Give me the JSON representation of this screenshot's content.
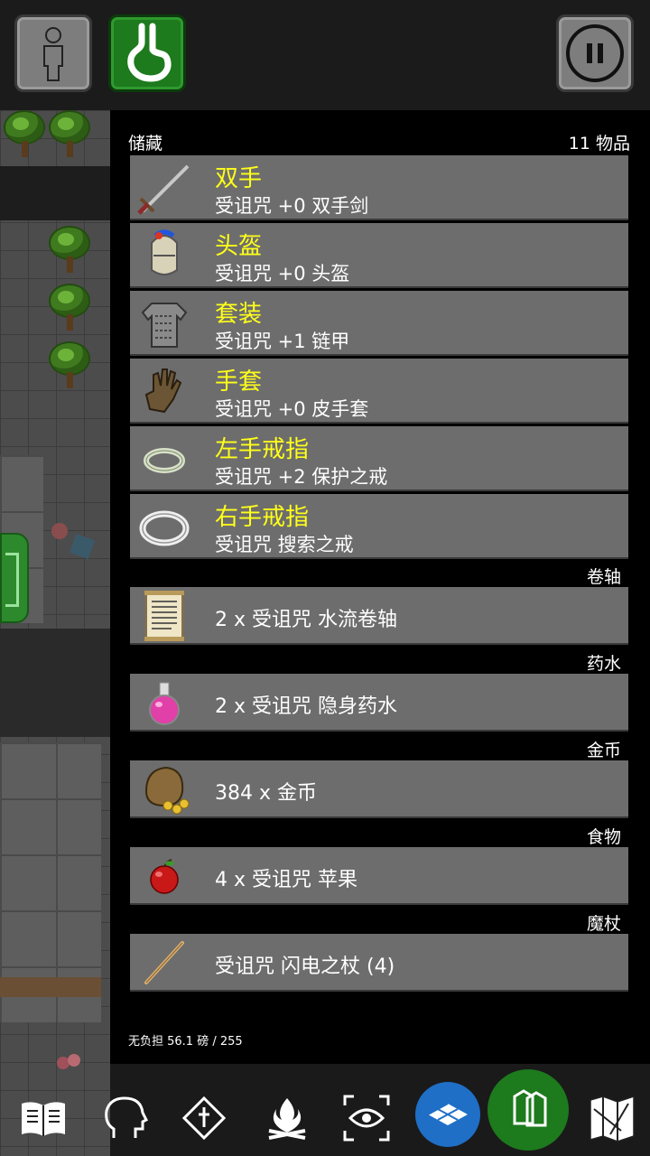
{
  "topbar": {
    "hero_icon": "hero-silhouette-icon",
    "hunger_icon": "stomach-icon",
    "pause_icon": "pause-icon"
  },
  "inventory": {
    "title": "储藏",
    "count": "11 物品",
    "equipped": [
      {
        "slot": "双手",
        "name": "受诅咒 +0 双手剑",
        "icon": "greatsword-icon"
      },
      {
        "slot": "头盔",
        "name": "受诅咒 +0 头盔",
        "icon": "helmet-icon"
      },
      {
        "slot": "套装",
        "name": "受诅咒 +1 链甲",
        "icon": "chainmail-icon"
      },
      {
        "slot": "手套",
        "name": "受诅咒 +0 皮手套",
        "icon": "leather-glove-icon"
      },
      {
        "slot": "左手戒指",
        "name": "受诅咒 +2 保护之戒",
        "icon": "ring-icon"
      },
      {
        "slot": "右手戒指",
        "name": "受诅咒 搜索之戒",
        "icon": "silver-ring-icon"
      }
    ],
    "categories": [
      {
        "label": "卷轴",
        "item": "2 x 受诅咒 水流卷轴",
        "icon": "scroll-icon"
      },
      {
        "label": "药水",
        "item": "2 x 受诅咒 隐身药水",
        "icon": "potion-icon"
      },
      {
        "label": "金币",
        "item": "384 x 金币",
        "icon": "gold-sack-icon"
      },
      {
        "label": "食物",
        "item": "4 x 受诅咒 苹果",
        "icon": "apple-icon"
      },
      {
        "label": "魔杖",
        "item": "受诅咒 闪电之杖 (4)",
        "icon": "wand-icon"
      }
    ],
    "weight": "无负担 56.1 磅 / 255"
  },
  "toolbar": [
    "journal-icon",
    "head-profile-icon",
    "spell-icon",
    "campfire-icon",
    "look-icon",
    "search-floor-icon",
    "inventory-icon",
    "map-icon"
  ],
  "colors": {
    "slot_text": "#ffff1a",
    "row_bg": "#6d6d6d",
    "accent_green": "#1d7a1d",
    "accent_blue": "#1f6fc7"
  }
}
